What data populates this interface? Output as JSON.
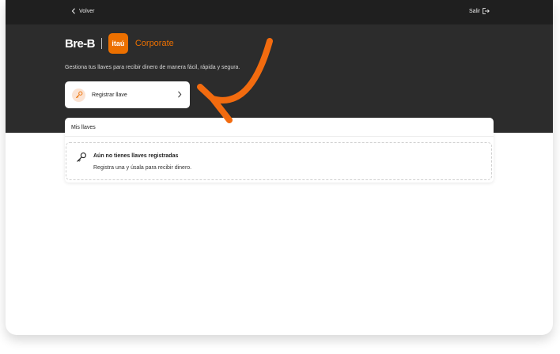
{
  "topbar": {
    "back_label": "Volver",
    "exit_label": "Salir"
  },
  "brand": {
    "product": "Bre-B",
    "bank": "itaú",
    "segment": "Corporate",
    "accent_color": "#ec7000"
  },
  "header": {
    "subtitle": "Gestiona tus llaves para recibir dinero de manera fácil, rápida y segura."
  },
  "register_card": {
    "label": "Registrar llave",
    "icon": "key-icon"
  },
  "keys_panel": {
    "title": "Mis llaves",
    "empty_title": "Aún no tienes llaves registradas",
    "empty_description": "Registra una y úsala para recibir dinero.",
    "icon": "key-icon"
  },
  "annotation": {
    "color": "#f26b0f"
  }
}
